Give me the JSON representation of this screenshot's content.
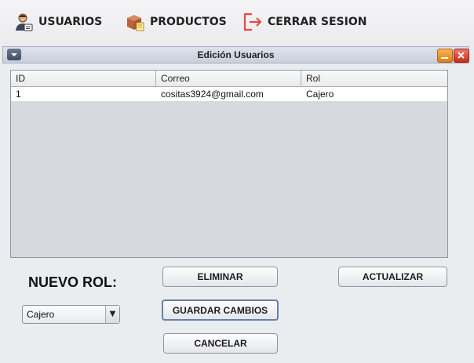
{
  "menubar": {
    "items": [
      {
        "label": "USUARIOS",
        "icon": "user-icon"
      },
      {
        "label": "PRODUCTOS",
        "icon": "package-icon"
      },
      {
        "label": "CERRAR SESION",
        "icon": "logout-icon"
      }
    ]
  },
  "window": {
    "title": "Edición Usuarios"
  },
  "table": {
    "columns": [
      "ID",
      "Correo",
      "Rol"
    ],
    "rows": [
      [
        "1",
        "cositas3924@gmail.com",
        "Cajero"
      ]
    ]
  },
  "form": {
    "rol_label": "NUEVO ROL:",
    "rol_selected": "Cajero"
  },
  "buttons": {
    "eliminar": "ELIMINAR",
    "actualizar": "ACTUALIZAR",
    "guardar": "GUARDAR CAMBIOS",
    "cancelar": "CANCELAR"
  },
  "colors": {
    "logout_accent": "#e64a4a",
    "close_button": "#cb2a17",
    "minimize_button": "#e07e17"
  }
}
